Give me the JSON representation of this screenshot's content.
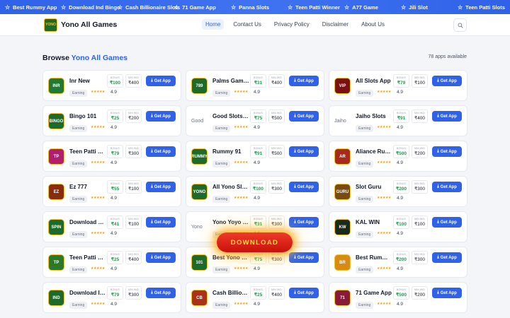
{
  "ticker": [
    "Best Rummy App",
    "Download Ind Bingo",
    "Cash Billionaire Slots",
    "71 Game App",
    "Panna Slots",
    "Teen Patti Winner",
    "A77 Game",
    "Jili Slot",
    "Teen Patti Slots"
  ],
  "header": {
    "brand": "Yono All Games",
    "brand_suffix": ".",
    "nav": [
      "Home",
      "Contact Us",
      "Privacy Policy",
      "Disclaimer",
      "About Us"
    ]
  },
  "section": {
    "title_prefix": "Browse ",
    "title_highlight": "Yono All Games",
    "count": "78 apps available"
  },
  "card_labels": {
    "bonus": "BONUS",
    "min_wd": "MIN W/D",
    "earning": "Earning",
    "get_app": "Get App",
    "stars": "★★★★★"
  },
  "apps": [
    {
      "name": "Inr New",
      "bonus": "₹100",
      "min_wd": "₹400",
      "rating": "4.9",
      "icon_text": "INR",
      "icon_color": "#1f7a33"
    },
    {
      "name": "Palms Gam…",
      "bonus": "₹31",
      "min_wd": "₹400",
      "rating": "4.9",
      "icon_text": "789",
      "icon_color": "#1d6b2a"
    },
    {
      "name": "All Slots App",
      "bonus": "₹79",
      "min_wd": "₹100",
      "rating": "4.9",
      "icon_text": "VIP",
      "icon_color": "#7a1010"
    },
    {
      "name": "Bingo 101",
      "bonus": "₹25",
      "min_wd": "₹200",
      "rating": "4.9",
      "icon_text": "BINGO",
      "icon_color": "#1d6b2a"
    },
    {
      "name": "Good Slots …",
      "bonus": "₹75",
      "min_wd": "₹500",
      "rating": "4.9",
      "icon_text": "Good",
      "icon_color": "",
      "broken": true
    },
    {
      "name": "Jaiho Slots",
      "bonus": "₹91",
      "min_wd": "₹400",
      "rating": "4.9",
      "icon_text": "Jaiho",
      "icon_color": "",
      "broken": true
    },
    {
      "name": "Teen Patti Y…",
      "bonus": "₹79",
      "min_wd": "₹300",
      "rating": "4.9",
      "icon_text": "TP",
      "icon_color": "#b31d6e"
    },
    {
      "name": "Rummy 91",
      "bonus": "₹91",
      "min_wd": "₹500",
      "rating": "4.9",
      "icon_text": "RUMMY",
      "icon_color": "#1d6b2a"
    },
    {
      "name": "Aliance Ru…",
      "bonus": "₹500",
      "min_wd": "₹200",
      "rating": "4.9",
      "icon_text": "AR",
      "icon_color": "#a82a1a"
    },
    {
      "name": "Ez 777",
      "bonus": "₹55",
      "min_wd": "₹100",
      "rating": "4.9",
      "icon_text": "EZ",
      "icon_color": "#8a2b0f"
    },
    {
      "name": "All Yono Slots",
      "bonus": "₹100",
      "min_wd": "₹300",
      "rating": "4.9",
      "icon_text": "YONO",
      "icon_color": "#1d6b2a"
    },
    {
      "name": "Slot Guru",
      "bonus": "₹200",
      "min_wd": "₹300",
      "rating": "4.9",
      "icon_text": "GURU",
      "icon_color": "#7a4b10"
    },
    {
      "name": "Download …",
      "bonus": "₹41",
      "min_wd": "₹100",
      "rating": "4.9",
      "icon_text": "SPIN",
      "icon_color": "#1d6b2a"
    },
    {
      "name": "Yono Yoyo …",
      "bonus": "₹31",
      "min_wd": "₹300",
      "rating": "4.9",
      "icon_text": "Yono",
      "icon_color": "",
      "broken": true
    },
    {
      "name": "KAL WIN",
      "bonus": "₹100",
      "min_wd": "₹100",
      "rating": "4.9",
      "icon_text": "KW",
      "icon_color": "#1a2a1a"
    },
    {
      "name": "Teen Patti …",
      "bonus": "₹25",
      "min_wd": "₹400",
      "rating": "4.9",
      "icon_text": "TP",
      "icon_color": "#2a7a2a"
    },
    {
      "name": "Best Yono …",
      "bonus": "₹75",
      "min_wd": "₹300",
      "rating": "4.9",
      "icon_text": "101",
      "icon_color": "#1d6b2a"
    },
    {
      "name": "Best Rumm…",
      "bonus": "₹200",
      "min_wd": "₹300",
      "rating": "4.9",
      "icon_text": "BR",
      "icon_color": "#d98a10"
    },
    {
      "name": "Download I…",
      "bonus": "₹79",
      "min_wd": "₹300",
      "rating": "4.9",
      "icon_text": "IND",
      "icon_color": "#1d6b2a"
    },
    {
      "name": "Cash Billion…",
      "bonus": "₹25",
      "min_wd": "₹400",
      "rating": "4.9",
      "icon_text": "CB",
      "icon_color": "#a8321a"
    },
    {
      "name": "71 Game App",
      "bonus": "₹500",
      "min_wd": "₹200",
      "rating": "4.9",
      "icon_text": "71",
      "icon_color": "#8a1a3a"
    }
  ],
  "overlay": {
    "download_label": "DOWNLOAD"
  },
  "colors": {
    "accent": "#2f62e8",
    "bonus": "#16a34a",
    "star": "#f59e0b",
    "download_bg": "#e0251a",
    "download_text": "#ffd54a"
  },
  "icons": {
    "ticker": "star-icon",
    "search": "search-icon",
    "get_app": "download-icon"
  }
}
